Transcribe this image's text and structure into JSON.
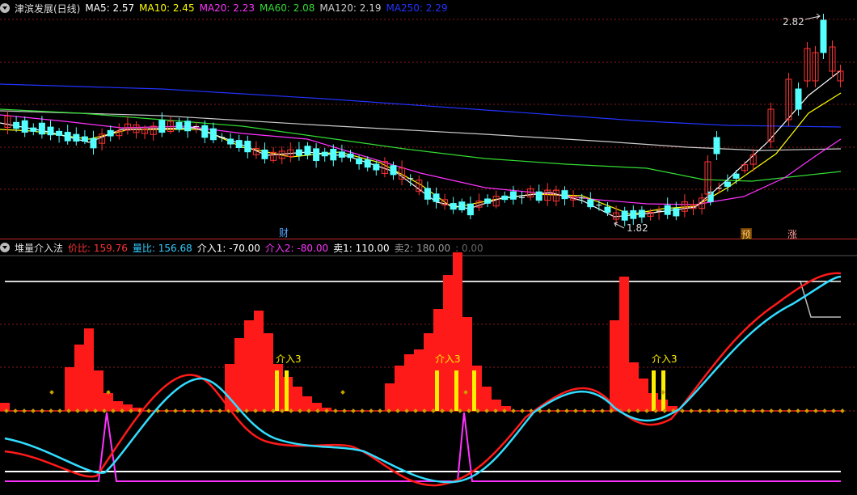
{
  "top": {
    "title": "津滨发展(日线)",
    "ma": [
      {
        "label": "MA5: ",
        "value": "2.57",
        "color": "#ffffff"
      },
      {
        "label": "MA10: ",
        "value": "2.45",
        "color": "#ffff00"
      },
      {
        "label": "MA20: ",
        "value": "2.23",
        "color": "#ff33ff"
      },
      {
        "label": "MA60: ",
        "value": "2.08",
        "color": "#33dd33"
      },
      {
        "label": "MA120: ",
        "value": "2.19",
        "color": "#cccccc"
      },
      {
        "label": "MA250: ",
        "value": "2.29",
        "color": "#2233ff"
      }
    ],
    "high_label": "2.82",
    "low_label": "1.82",
    "marker_cai": "财",
    "marker_yu": "预",
    "marker_zhang": "涨"
  },
  "bottom": {
    "title": "堆量介入法",
    "values": [
      {
        "label": "价比: ",
        "value": "159.76",
        "color": "#ff3333"
      },
      {
        "label": "量比: ",
        "value": "156.68",
        "color": "#33ccff"
      },
      {
        "label": "介入1: ",
        "value": "-70.00",
        "color": "#ffffff"
      },
      {
        "label": "介入2: ",
        "value": "-80.00",
        "color": "#ff33ff"
      },
      {
        "label": "卖1: ",
        "value": "110.00",
        "color": "#ffffff"
      },
      {
        "label": "卖2: ",
        "value": "180.00",
        "color": "#999999"
      },
      {
        "label": "",
        "value": ": 0.00",
        "color": "#666666"
      }
    ],
    "signal_label": "介入3"
  },
  "colors": {
    "up": "#ff3333",
    "down": "#54ffff",
    "grid": "#8b1a1a",
    "cross": "#ffffff"
  }
}
